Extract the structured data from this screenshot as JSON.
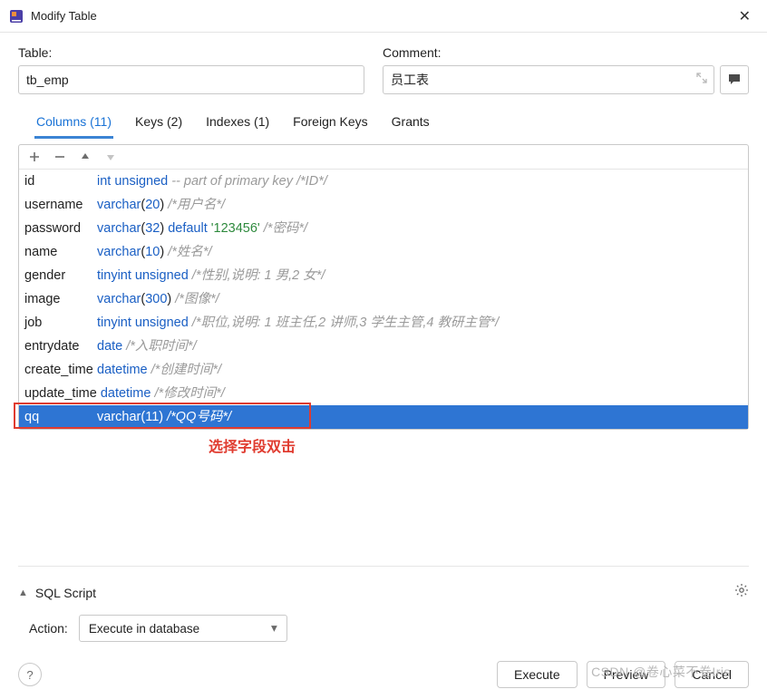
{
  "window": {
    "title": "Modify Table"
  },
  "labels": {
    "table": "Table:",
    "comment": "Comment:"
  },
  "inputs": {
    "table": "tb_emp",
    "comment": "员工表"
  },
  "tabs": {
    "columns": "Columns (11)",
    "keys": "Keys (2)",
    "indexes": "Indexes (1)",
    "foreign_keys": "Foreign Keys",
    "grants": "Grants"
  },
  "columns": [
    {
      "name": "id",
      "type_kw": "int unsigned",
      "size": "",
      "default_kw": "",
      "default_val": "",
      "comment": " -- part of primary key /*ID*/",
      "selected": false
    },
    {
      "name": "username",
      "type_kw": "varchar",
      "size": "20",
      "default_kw": "",
      "default_val": "",
      "comment": " /*用户名*/",
      "selected": false
    },
    {
      "name": "password",
      "type_kw": "varchar",
      "size": "32",
      "default_kw": " default ",
      "default_val": "'123456'",
      "comment": " /*密码*/",
      "selected": false
    },
    {
      "name": "name",
      "type_kw": "varchar",
      "size": "10",
      "default_kw": "",
      "default_val": "",
      "comment": " /*姓名*/",
      "selected": false
    },
    {
      "name": "gender",
      "type_kw": "tinyint unsigned",
      "size": "",
      "default_kw": "",
      "default_val": "",
      "comment": " /*性别,说明: 1 男,2 女*/",
      "selected": false
    },
    {
      "name": "image",
      "type_kw": "varchar",
      "size": "300",
      "default_kw": "",
      "default_val": "",
      "comment": " /*图像*/",
      "selected": false
    },
    {
      "name": "job",
      "type_kw": "tinyint unsigned",
      "size": "",
      "default_kw": "",
      "default_val": "",
      "comment": " /*职位,说明: 1 班主任,2 讲师,3 学生主管,4 教研主管*/",
      "selected": false
    },
    {
      "name": "entrydate",
      "type_kw": "date",
      "size": "",
      "default_kw": "",
      "default_val": "",
      "comment": " /*入职时间*/",
      "selected": false
    },
    {
      "name": "create_time",
      "type_kw": "datetime",
      "size": "",
      "default_kw": "",
      "default_val": "",
      "comment": " /*创建时间*/",
      "selected": false
    },
    {
      "name": "update_time",
      "type_kw": "datetime",
      "size": "",
      "default_kw": "",
      "default_val": "",
      "comment": " /*修改时间*/",
      "selected": false
    },
    {
      "name": "qq",
      "type_kw": "varchar",
      "size": "11",
      "default_kw": "",
      "default_val": "",
      "comment": " /*QQ号码*/",
      "selected": true
    }
  ],
  "annotation": "选择字段双击",
  "sql_script": {
    "title": "SQL Script"
  },
  "action": {
    "label": "Action:",
    "value": "Execute in database"
  },
  "buttons": {
    "execute": "Execute",
    "preview": "Preview",
    "cancel": "Cancel"
  },
  "watermark": "CSDN @卷心菜不卷Iris"
}
